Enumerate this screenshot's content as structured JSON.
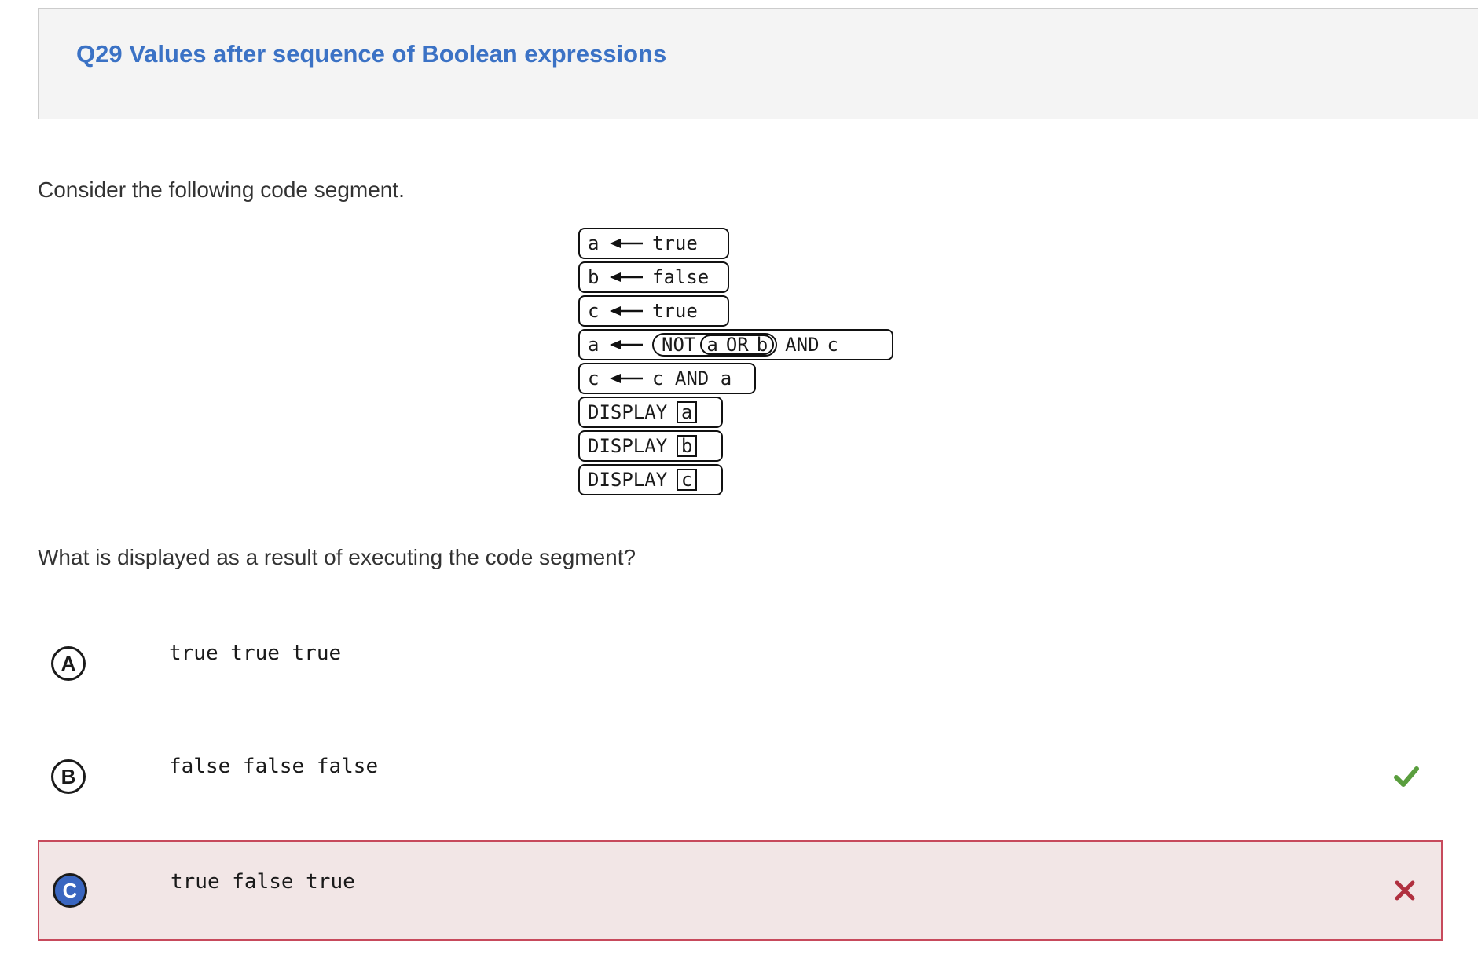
{
  "question": {
    "title": "Q29 Values after sequence of Boolean expressions",
    "prompt_intro": "Consider the following code segment.",
    "prompt_question": "What is displayed as a result of executing the code segment?"
  },
  "code": {
    "line1": {
      "var": "a",
      "value": "true"
    },
    "line2": {
      "var": "b",
      "value": "false"
    },
    "line3": {
      "var": "c",
      "value": "true"
    },
    "line4": {
      "var": "a",
      "not": "NOT",
      "inner_a": "a",
      "inner_or": "OR",
      "inner_b": "b",
      "and": "AND",
      "c": "c"
    },
    "line5": {
      "var": "c",
      "expr": "c AND a"
    },
    "display1": {
      "keyword": "DISPLAY",
      "arg": "a"
    },
    "display2": {
      "keyword": "DISPLAY",
      "arg": "b"
    },
    "display3": {
      "keyword": "DISPLAY",
      "arg": "c"
    }
  },
  "options": [
    {
      "letter": "A",
      "text": "true true true",
      "state": "none"
    },
    {
      "letter": "B",
      "text": "false false false",
      "state": "correct"
    },
    {
      "letter": "C",
      "text": "true false true",
      "state": "selected-wrong"
    }
  ],
  "icons": {
    "correct": "check-icon",
    "wrong": "x-icon",
    "assign": "left-arrow-icon"
  },
  "colors": {
    "title": "#3b72c5",
    "correct": "#5a9e3e",
    "wrong": "#b0303f",
    "selected_bg": "#f2e6e6",
    "selected_border": "#c74a5c",
    "selected_letter_bg": "#3a66c0"
  }
}
